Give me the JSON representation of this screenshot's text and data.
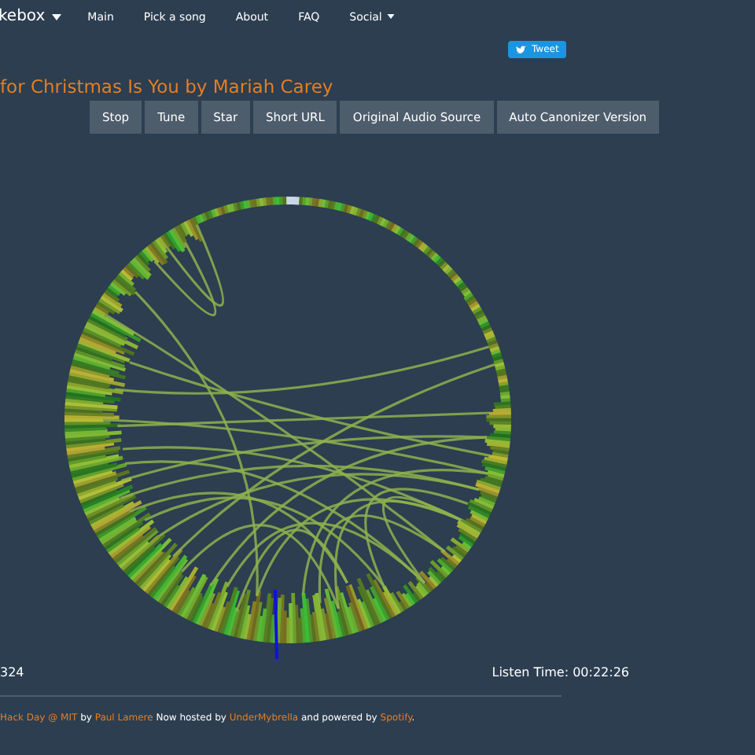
{
  "navbar": {
    "brand": "kebox",
    "brand_dropdown": true,
    "items": [
      {
        "label": "Main",
        "dropdown": false
      },
      {
        "label": "Pick a song",
        "dropdown": false
      },
      {
        "label": "About",
        "dropdown": false
      },
      {
        "label": "FAQ",
        "dropdown": false
      },
      {
        "label": "Social",
        "dropdown": true
      }
    ]
  },
  "tweet_button": "Tweet",
  "song_title": "for Christmas Is You by Mariah Carey",
  "buttons": [
    "Stop",
    "Tune",
    "Star",
    "Short URL",
    "Original Audio Source",
    "Auto Canonizer Version"
  ],
  "stats": {
    "beats": "324",
    "listen_time": "Listen Time: 00:22:26"
  },
  "footer": [
    {
      "kind": "link",
      "text": "Hack Day @ MIT"
    },
    {
      "kind": "text",
      "text": "by"
    },
    {
      "kind": "link",
      "text": "Paul Lamere"
    },
    {
      "kind": "text",
      "text": "Now hosted by"
    },
    {
      "kind": "link",
      "text": "UnderMybrella"
    },
    {
      "kind": "text",
      "text": "and powered by"
    },
    {
      "kind": "link",
      "text": "Spotify"
    },
    {
      "kind": "text",
      "text": "."
    }
  ]
}
